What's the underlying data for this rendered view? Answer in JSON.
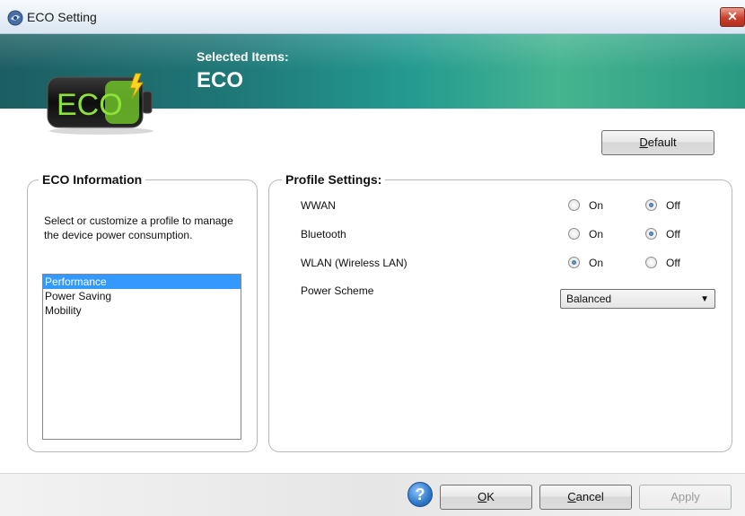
{
  "window": {
    "title": "ECO Setting",
    "close_symbol": "✕"
  },
  "banner": {
    "subtitle": "Selected Items:",
    "title": "ECO",
    "logo_text": "ECO"
  },
  "default_button": {
    "accel": "D",
    "rest": "efault"
  },
  "eco_info": {
    "title": "ECO Information",
    "description": "Select or customize a profile to manage the device power consumption.",
    "profiles": [
      {
        "label": "Performance",
        "selected": true
      },
      {
        "label": "Power Saving",
        "selected": false
      },
      {
        "label": "Mobility",
        "selected": false
      }
    ]
  },
  "profile_settings": {
    "title": "Profile Settings:",
    "on_label": "On",
    "off_label": "Off",
    "rows": [
      {
        "label": "WWAN",
        "value": "Off"
      },
      {
        "label": "Bluetooth",
        "value": "Off"
      },
      {
        "label": "WLAN (Wireless LAN)",
        "value": "On"
      }
    ],
    "power_scheme": {
      "label": "Power Scheme",
      "value": "Balanced"
    }
  },
  "footer": {
    "help_symbol": "?",
    "ok": {
      "accel": "O",
      "rest": "K"
    },
    "cancel": {
      "accel": "C",
      "rest": "ancel"
    },
    "apply": {
      "label": "Apply",
      "disabled": true
    }
  },
  "colors": {
    "selection": "#3399ff",
    "banner_start": "#1c5e62",
    "banner_end": "#45b48f",
    "battery_green": "#7ed321"
  },
  "icons": {
    "title": "eco-app-icon",
    "help": "help-icon",
    "close": "close-icon",
    "dropdown": "chevron-down-icon"
  }
}
